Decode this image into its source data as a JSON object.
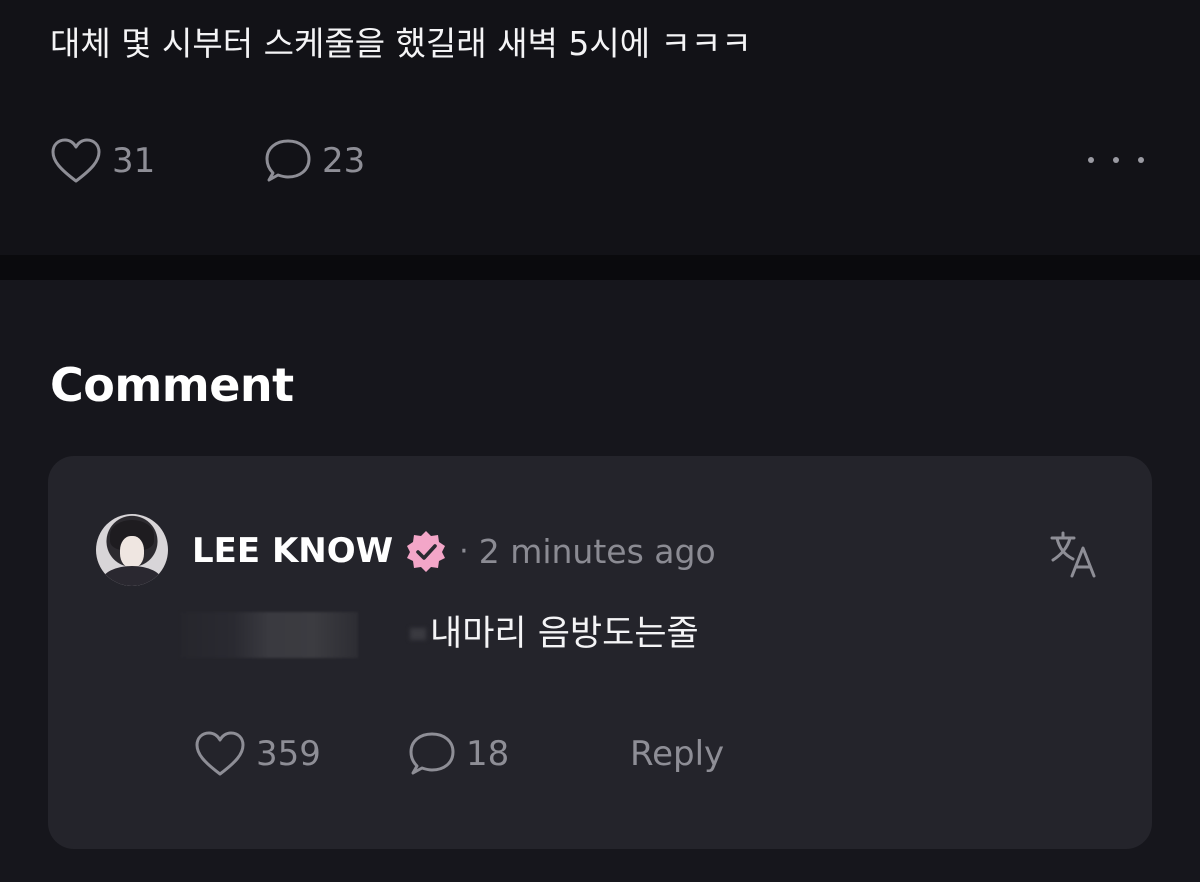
{
  "post": {
    "text": "대체 몇 시부터 스케줄을 했길래 새벽 5시에 ㅋㅋㅋ",
    "like_count": "31",
    "comment_count": "23",
    "icons": {
      "like": "heart-icon",
      "comment": "speech-bubble-icon",
      "more": "more-horizontal-icon"
    }
  },
  "comments_section": {
    "title": "Comment"
  },
  "comment": {
    "author": "LEE KNOW",
    "separator": "·",
    "timestamp": "2 minutes ago",
    "text": "내마리 음방도는줄",
    "like_count": "359",
    "reply_count": "18",
    "reply_label": "Reply",
    "icons": {
      "verified": "verified-badge-icon",
      "translate": "translate-icon",
      "like": "heart-icon",
      "comment": "speech-bubble-icon"
    }
  },
  "colors": {
    "page_background": "#16161c",
    "post_background": "#121217",
    "card_background": "#24242b",
    "verified_badge": "#f3a6c8",
    "muted_text": "#8e8e96"
  }
}
